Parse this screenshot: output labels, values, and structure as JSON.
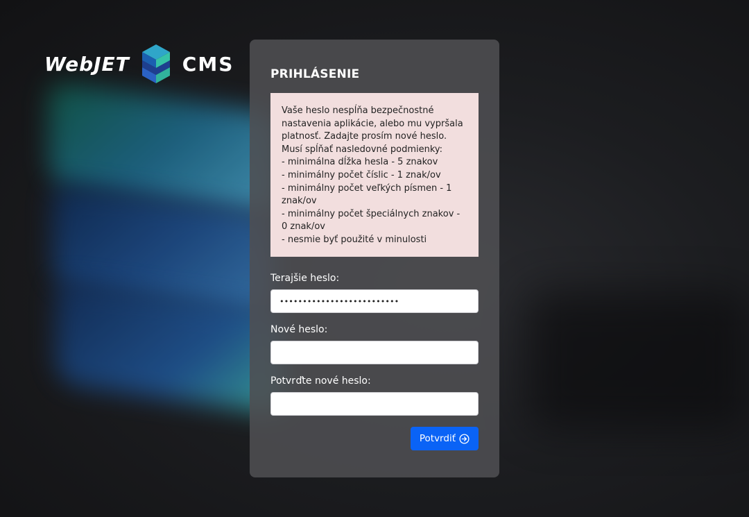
{
  "brand": {
    "word_left": "WebJET",
    "word_right": "CMS",
    "colors": {
      "accent": "#0a63f6",
      "alert_background": "#f2dede",
      "panel_background": "#4e4e52"
    }
  },
  "login": {
    "title": "PRIHLÁSENIE",
    "alert": {
      "intro": "Vaše heslo nespĺňa bezpečnostné nastavenia aplikácie, alebo mu vypršala platnosť. Zadajte prosím nové heslo. Musí spĺňať nasledovné podmienky:",
      "rules": [
        "- minimálna dĺžka hesla - 5 znakov",
        "- minimálny počet číslic - 1 znak/ov",
        "- minimálny počet veľkých písmen - 1 znak/ov",
        "- minimálny počet špeciálnych znakov - 0 znak/ov",
        "- nesmie byť použité v minulosti"
      ]
    },
    "fields": {
      "current": {
        "label": "Terajšie heslo:",
        "value": "••••••••••••••••••••••••••"
      },
      "new": {
        "label": "Nové heslo:",
        "value": ""
      },
      "confirm": {
        "label": "Potvrďte nové heslo:",
        "value": ""
      }
    },
    "submit": {
      "label": "Potvrdiť",
      "icon": "arrow-circle-right-icon"
    }
  }
}
